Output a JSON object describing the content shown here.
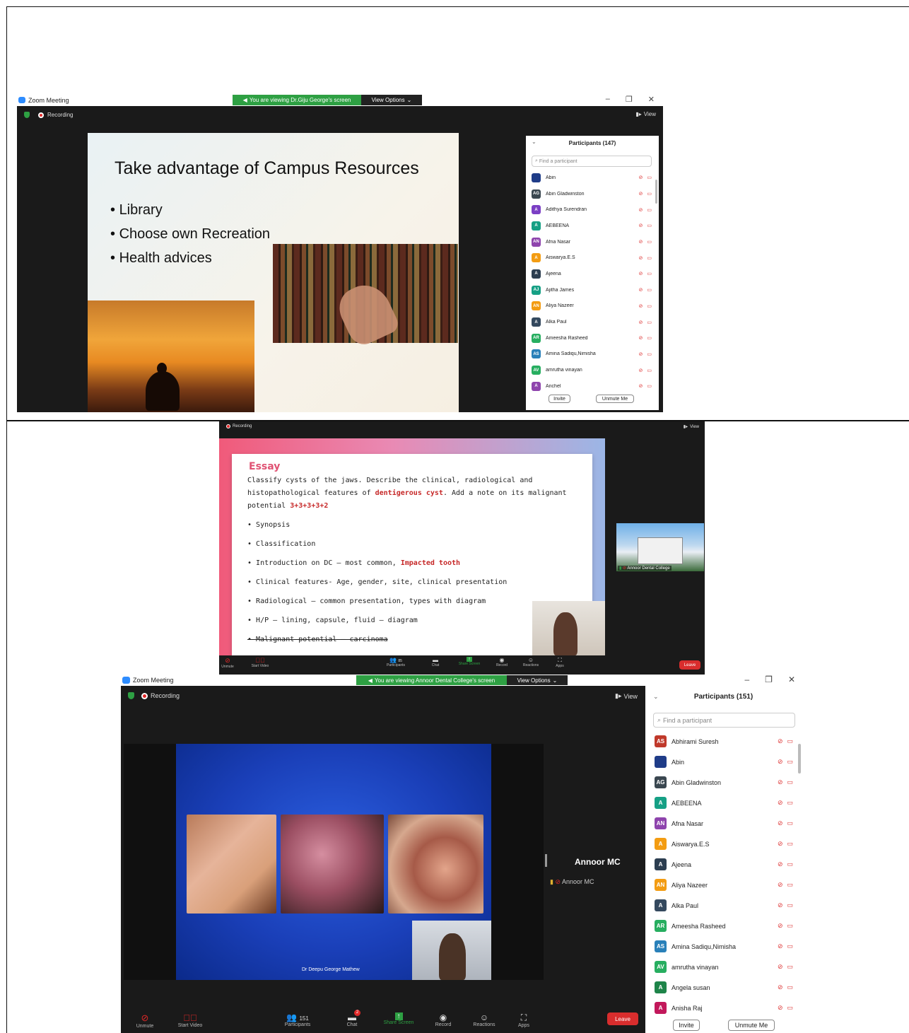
{
  "panel1": {
    "app_title": "Zoom Meeting",
    "viewing_banner": "You are viewing Dr.Giju George's screen",
    "view_options": "View Options",
    "recording": "Recording",
    "view": "View",
    "slide": {
      "title": "Take advantage of Campus Resources",
      "bullets": [
        "Library",
        "Choose own Recreation",
        "Health advices"
      ]
    },
    "participants": {
      "header": "Participants (147)",
      "search_placeholder": "Find a participant",
      "list": [
        {
          "initials": "",
          "name": "Abin",
          "color": "#1f3c88"
        },
        {
          "initials": "AG",
          "name": "Abin Gladwinston",
          "color": "#3a4750"
        },
        {
          "initials": "A",
          "name": "Adithya Surendran",
          "color": "#7b3fc4"
        },
        {
          "initials": "A",
          "name": "AEBEENA",
          "color": "#16a085"
        },
        {
          "initials": "AN",
          "name": "Afna Nasar",
          "color": "#8e44ad"
        },
        {
          "initials": "A",
          "name": "Aiswarya.E.S",
          "color": "#f39c12"
        },
        {
          "initials": "A",
          "name": "Ajeena",
          "color": "#2c3e50"
        },
        {
          "initials": "AJ",
          "name": "Ajitha James",
          "color": "#16a085"
        },
        {
          "initials": "AN",
          "name": "Aliya Nazeer",
          "color": "#f39c12"
        },
        {
          "initials": "A",
          "name": "Alka Paul",
          "color": "#34495e"
        },
        {
          "initials": "AR",
          "name": "Ameesha Rasheed",
          "color": "#27ae60"
        },
        {
          "initials": "AS",
          "name": "Amina Sadiqu,Nimisha",
          "color": "#2980b9"
        },
        {
          "initials": "AV",
          "name": "amrutha vinayan",
          "color": "#27ae60"
        },
        {
          "initials": "A",
          "name": "Anchel",
          "color": "#8e44ad"
        }
      ],
      "invite": "Invite",
      "unmute_me": "Unmute Me"
    }
  },
  "panel2": {
    "recording": "Recording",
    "view": "View",
    "essay": {
      "heading": "Essay",
      "line1": "Classify cysts of the jaws. Describe the clinical, radiological and",
      "line2_pre": "histopathological features of ",
      "line2_em": "dentigerous cyst",
      "line2_post": ". Add a note on its malignant",
      "line3_pre": "potential ",
      "line3_em": "3+3+3+3+2",
      "points": [
        "Synopsis",
        "Classification",
        "Introduction on DC – most common, ",
        "Clinical features- Age, gender, site, clinical presentation",
        "Radiological – common presentation, types with diagram",
        "H/P – lining, capsule, fluid – diagram",
        "Malignant potential – carcinoma"
      ],
      "point3_em": "Impacted tooth"
    },
    "video_tile_name": "Annoor Dental College",
    "toolbar": {
      "unmute": "Unmute",
      "start_video": "Start Video",
      "participants_count": "85",
      "participants": "Participants",
      "chat": "Chat",
      "share_screen": "Share Screen",
      "record": "Record",
      "reactions": "Reactions",
      "apps": "Apps",
      "leave": "Leave"
    }
  },
  "panel3": {
    "app_title": "Zoom Meeting",
    "viewing_banner": "You are viewing Annoor Dental College's screen",
    "view_options": "View Options",
    "recording": "Recording",
    "view": "View",
    "presenter_caption": "Dr Deepu George Mathew",
    "side_tile_title": "Annoor MC",
    "side_tile_name": "Annoor MC",
    "participants": {
      "header": "Participants (151)",
      "search_placeholder": "Find a participant",
      "list": [
        {
          "initials": "AS",
          "name": "Abhirami Suresh",
          "color": "#c0392b"
        },
        {
          "initials": "",
          "name": "Abin",
          "color": "#1f3c88"
        },
        {
          "initials": "AG",
          "name": "Abin Gladwinston",
          "color": "#3a4750"
        },
        {
          "initials": "A",
          "name": "AEBEENA",
          "color": "#16a085"
        },
        {
          "initials": "AN",
          "name": "Afna Nasar",
          "color": "#8e44ad"
        },
        {
          "initials": "A",
          "name": "Aiswarya.E.S",
          "color": "#f39c12"
        },
        {
          "initials": "A",
          "name": "Ajeena",
          "color": "#2c3e50"
        },
        {
          "initials": "AN",
          "name": "Aliya Nazeer",
          "color": "#f39c12"
        },
        {
          "initials": "A",
          "name": "Alka Paul",
          "color": "#34495e"
        },
        {
          "initials": "AR",
          "name": "Ameesha Rasheed",
          "color": "#27ae60"
        },
        {
          "initials": "AS",
          "name": "Amina Sadiqu,Nimisha",
          "color": "#2980b9"
        },
        {
          "initials": "AV",
          "name": "amrutha vinayan",
          "color": "#27ae60"
        },
        {
          "initials": "A",
          "name": "Angela susan",
          "color": "#1e8449"
        },
        {
          "initials": "A",
          "name": "Anisha Raj",
          "color": "#c2185b"
        }
      ],
      "invite": "Invite",
      "unmute_me": "Unmute Me"
    },
    "toolbar": {
      "unmute": "Unmute",
      "start_video": "Start Video",
      "participants_count": "151",
      "participants": "Participants",
      "chat": "Chat",
      "chat_badge": "2",
      "share_screen": "Share Screen",
      "record": "Record",
      "reactions": "Reactions",
      "apps": "Apps",
      "leave": "Leave"
    }
  }
}
